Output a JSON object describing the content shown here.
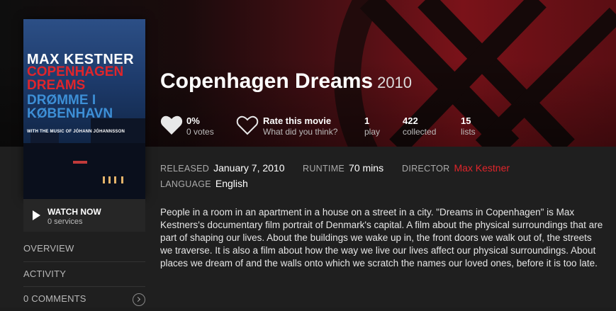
{
  "poster": {
    "line1": "MAX KESTNER",
    "line2": "COPENHAGEN",
    "line3": "DREAMS",
    "line4": "DRØMME I",
    "line5": "KØBENHAVN",
    "line6": "WITH THE MUSIC OF JÓHANN JÓHANNSSON"
  },
  "watch": {
    "label": "WATCH NOW",
    "sub": "0 services"
  },
  "nav": {
    "overview": "OVERVIEW",
    "activity": "ACTIVITY",
    "comments": "0 COMMENTS"
  },
  "title": "Copenhagen Dreams",
  "year": "2010",
  "stats": {
    "rating_pct": "0%",
    "votes": "0 votes",
    "rate_label": "Rate this movie",
    "rate_sub": "What did you think?",
    "plays": "1",
    "plays_label": "play",
    "collected": "422",
    "collected_label": "collected",
    "lists": "15",
    "lists_label": "lists"
  },
  "meta": {
    "released_key": "RELEASED",
    "released": "January 7, 2010",
    "runtime_key": "RUNTIME",
    "runtime": "70 mins",
    "director_key": "DIRECTOR",
    "director": "Max Kestner",
    "language_key": "LANGUAGE",
    "language": "English"
  },
  "description": "People in a room in an apartment in a house on a street in a city. \"Dreams in Copenhagen\" is Max Kestners's documentary film portrait of Denmark's capital. A film about the physical surroundings that are part of shaping our lives. About the buildings we wake up in, the front doors we walk out of, the streets we traverse. It is also a film about how the way we live our lives affect our physical surroundings. About places we dream of and the walls onto which we scratch the names our loved ones, before it is too late.",
  "colors": {
    "accent": "#e0252b",
    "background": "#1f1f1f"
  },
  "icons": {
    "heart_filled": "heart-filled-icon",
    "heart_outline": "heart-outline-icon",
    "play": "play-icon",
    "chevron": "chevron-right-icon"
  }
}
